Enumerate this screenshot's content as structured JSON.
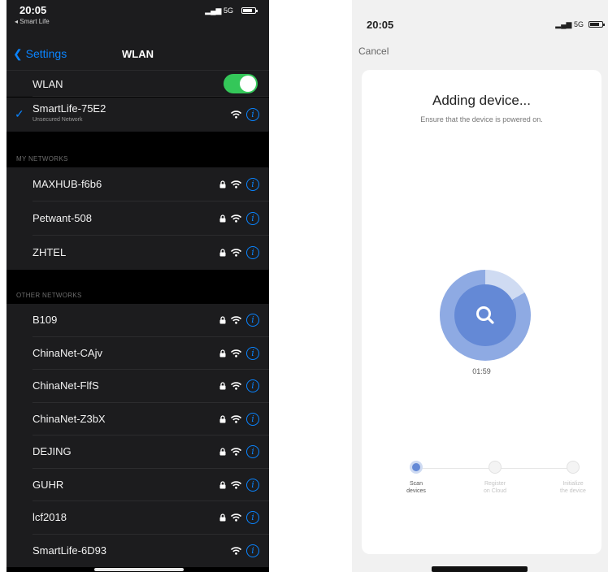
{
  "left_phone": {
    "status": {
      "time": "20:05",
      "back_app": "◂ Smart Life",
      "network": "5G"
    },
    "nav": {
      "back_label": "Settings",
      "title": "WLAN"
    },
    "wlan": {
      "label": "WLAN",
      "enabled": true
    },
    "connected": {
      "name": "SmartLife-75E2",
      "subtitle": "Unsecured Network"
    },
    "my_networks": {
      "header": "MY NETWORKS",
      "items": [
        {
          "name": "MAXHUB-f6b6",
          "locked": true
        },
        {
          "name": "Petwant-508",
          "locked": true
        },
        {
          "name": "ZHTEL",
          "locked": true
        }
      ]
    },
    "other_networks": {
      "header": "OTHER NETWORKS",
      "items": [
        {
          "name": "B109",
          "locked": true
        },
        {
          "name": "ChinaNet-CAjv",
          "locked": true
        },
        {
          "name": "ChinaNet-FlfS",
          "locked": true
        },
        {
          "name": "ChinaNet-Z3bX",
          "locked": true
        },
        {
          "name": "DEJING",
          "locked": true
        },
        {
          "name": "GUHR",
          "locked": true
        },
        {
          "name": "lcf2018",
          "locked": true
        },
        {
          "name": "SmartLife-6D93",
          "locked": false
        }
      ]
    },
    "colors": {
      "accent": "#0a84ff",
      "toggle_on": "#34c759"
    }
  },
  "right_phone": {
    "status": {
      "time": "20:05",
      "network": "5G"
    },
    "cancel_label": "Cancel",
    "title": "Adding device...",
    "subtitle": "Ensure that the device is powered on.",
    "timer": "01:59",
    "steps": [
      {
        "label_line1": "Scan",
        "label_line2": "devices",
        "active": true
      },
      {
        "label_line1": "Register",
        "label_line2": "on Cloud",
        "active": false
      },
      {
        "label_line1": "Initialize",
        "label_line2": "the device",
        "active": false
      }
    ],
    "colors": {
      "scan_blue": "#6489d6",
      "scan_ring": "#8eaae3"
    }
  }
}
